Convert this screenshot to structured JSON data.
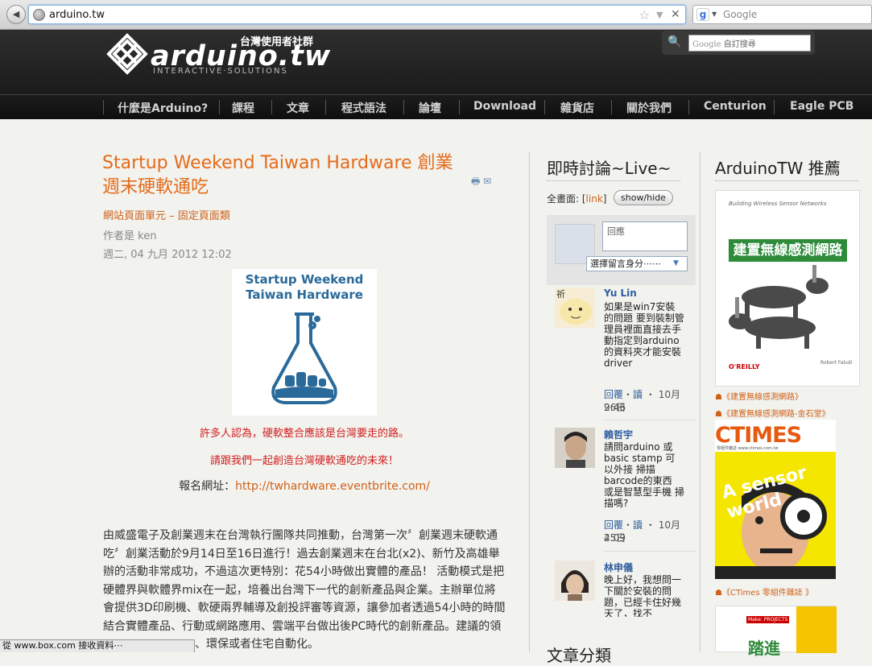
{
  "browser": {
    "url": "arduino.tw",
    "search_placeholder": "Google",
    "status_text": "從 www.box.com 接收資料⋯"
  },
  "header": {
    "logo_text": "arduino.tw",
    "logo_sub": "INTERACTIVE·SOLUTIONS",
    "logo_tag": "台灣使用者社群",
    "search_placeholder": "自訂搜尋"
  },
  "nav": {
    "items": [
      {
        "label": "什麼是Arduino?"
      },
      {
        "label": "課程"
      },
      {
        "label": "文章"
      },
      {
        "label": "程式語法"
      },
      {
        "label": "論壇"
      },
      {
        "label": "Download"
      },
      {
        "label": "雜貨店"
      },
      {
        "label": "關於我們"
      },
      {
        "label": "Centurion"
      },
      {
        "label": "Eagle PCB"
      }
    ]
  },
  "article": {
    "title": "Startup Weekend Taiwan Hardware 創業週末硬軟通吃",
    "categories": "網站頁面單元 – 固定頁面類",
    "author": "作者是 ken",
    "date": "週二, 04 九月 2012 12:02",
    "image_line1": "Startup Weekend",
    "image_line2": "Taiwan Hardware",
    "red_line1": "許多人認為，硬軟整合應該是台灣要走的路。",
    "red_line2": "請跟我們一起創造台灣硬軟通吃的未來！",
    "register_label": "報名網址：",
    "register_link": "http://twhardware.eventbrite.com/",
    "body": "由威盛電子及創業週末在台灣執行團隊共同推動，台灣第一次〞創業週末硬軟通吃〞創業活動於9月14日至16日進行！過去創業週末在台北(x2)、新竹及高雄舉辦的活動非常成功，不過這次更特別：花54小時做出實體的產品！ 活動模式是把硬體界與軟體界mix在一起，培養出台灣下一代的創新產品與企業。主辦單位將會提供3D印刷機、軟硬兩界輔導及創投評審等資源，讓參加者透過54小時的時間結合實體產品、行動或網路應用、雲端平台做出後PC時代的創新產品。建議的領",
    "body_tail": "、環保或者住宅自動化。"
  },
  "live": {
    "title": "即時討論~Live~",
    "full_label": "全畫面: [",
    "full_link": "link",
    "full_close": "]",
    "showhide": "show/hide",
    "reply_placeholder": "回應",
    "identity_select": "選擇留言身分⋯⋯",
    "comments": [
      {
        "name": "Yu Lin",
        "text": "如果是win7安裝的問題 要到裝制管理員裡面直接去手動指定到arduino的資料夾才能安裝driver",
        "reply": "回覆",
        "dot": "・",
        "read": "讀",
        "date": "・ 10月26日",
        "time": "9:46"
      },
      {
        "name": "賴哲宇",
        "text": "請問arduino 或 basic stamp 可以外接 掃描barcode的東西 或是智慧型手機 掃描嗎?",
        "reply": "回覆",
        "dot": "・",
        "read": "讀",
        "date": "・ 10月25日",
        "time": "4:09"
      },
      {
        "name": "林申儀",
        "text": "晚上好，我想問一下關於安裝的問題，已經卡住好幾天了，找不",
        "reply": "",
        "dot": "",
        "read": "",
        "date": "",
        "time": ""
      }
    ],
    "next_section": "文章分類"
  },
  "recommend": {
    "title": "ArduinoTW 推薦",
    "book1_top": "Building Wireless Sensor Networks",
    "book1_band": "建置無線感測網路",
    "book1_brand": "O'REILLY",
    "book1_author": "Robert Faludi",
    "links": [
      "《建置無線感測網路》",
      "《建置無線感測網路-金石堂》",
      "《CTimes 零組件雜誌 》"
    ],
    "ctimes_logo": "CTIMES",
    "ctimes_sub": "零組件雜誌 www.ctimes.com.tw",
    "ctimes_cover": "A sensor world",
    "book3_tag": "Make: PROJECTS",
    "book3_title": "踏進"
  }
}
